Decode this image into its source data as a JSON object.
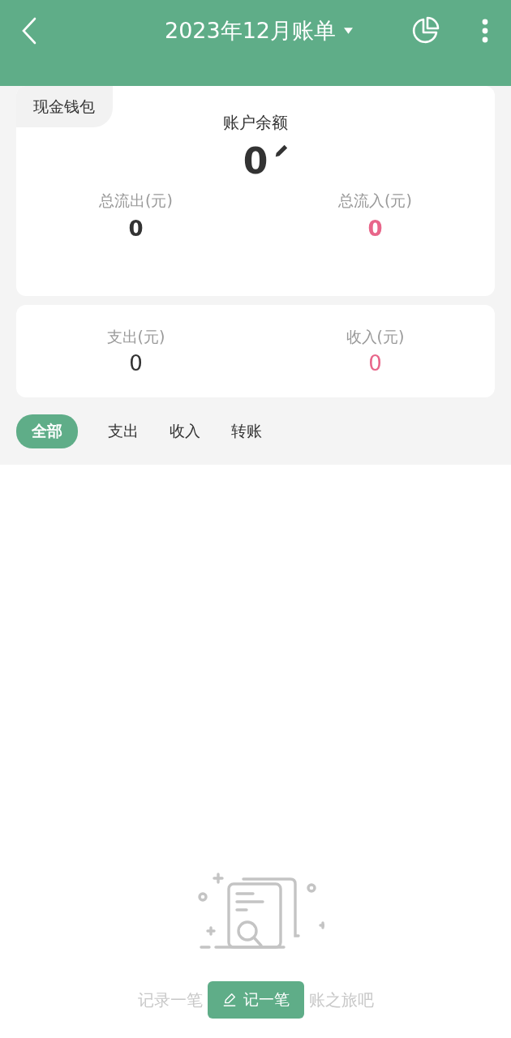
{
  "top_bar": {
    "title": "2023年12月账单"
  },
  "account_card": {
    "tag": "现金钱包",
    "balance_label": "账户余额",
    "balance": "0",
    "stats": [
      {
        "label": "总流出(元)",
        "value": "0",
        "kind": "out"
      },
      {
        "label": "总流入(元)",
        "value": "0",
        "kind": "in"
      }
    ]
  },
  "month_card": {
    "stats": [
      {
        "label": "支出(元)",
        "value": "0",
        "kind": "out"
      },
      {
        "label": "收入(元)",
        "value": "0",
        "kind": "in"
      }
    ]
  },
  "tabs": [
    {
      "label": "全部",
      "selected": true
    },
    {
      "label": "支出",
      "selected": false
    },
    {
      "label": "收入",
      "selected": false
    },
    {
      "label": "转账",
      "selected": false
    }
  ],
  "empty_state": {
    "hint_before": "记录一笔",
    "button": "记一笔",
    "hint_after": "账之旅吧"
  }
}
